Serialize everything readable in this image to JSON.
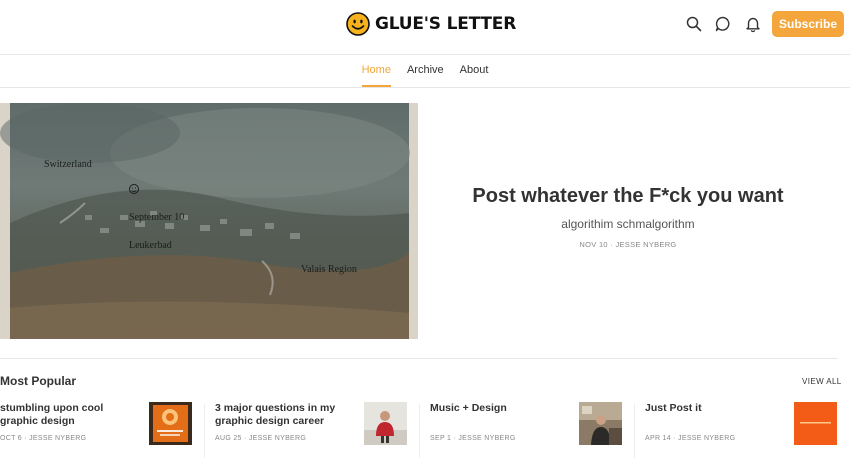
{
  "header": {
    "brand": "GLUE'S LETTER",
    "icons": [
      "search-icon",
      "chat-icon",
      "bell-icon"
    ],
    "subscribe_label": "Subscribe",
    "accent": "#f4a63c"
  },
  "nav": {
    "tabs": [
      {
        "label": "Home",
        "active": true
      },
      {
        "label": "Archive",
        "active": false
      },
      {
        "label": "About",
        "active": false
      }
    ]
  },
  "hero": {
    "image_labels": {
      "country": "Switzerland",
      "date": "September 10",
      "place": "Leukerbad",
      "region": "Valais Region"
    },
    "title": "Post whatever the F*ck you want",
    "subtitle": "algorithim schmalgorithm",
    "meta": "NOV 10 · JESSE NYBERG"
  },
  "popular": {
    "heading": "Most Popular",
    "view_all": "VIEW ALL",
    "posts": [
      {
        "title": "stumbling upon cool graphic design",
        "meta": "OCT 6 · JESSE NYBERG"
      },
      {
        "title": "3 major questions in my graphic design career",
        "meta": "AUG 25 · JESSE NYBERG"
      },
      {
        "title": "Music + Design",
        "meta": "SEP 1 · JESSE NYBERG"
      },
      {
        "title": "Just Post it",
        "meta": "APR 14 · JESSE NYBERG"
      }
    ]
  }
}
